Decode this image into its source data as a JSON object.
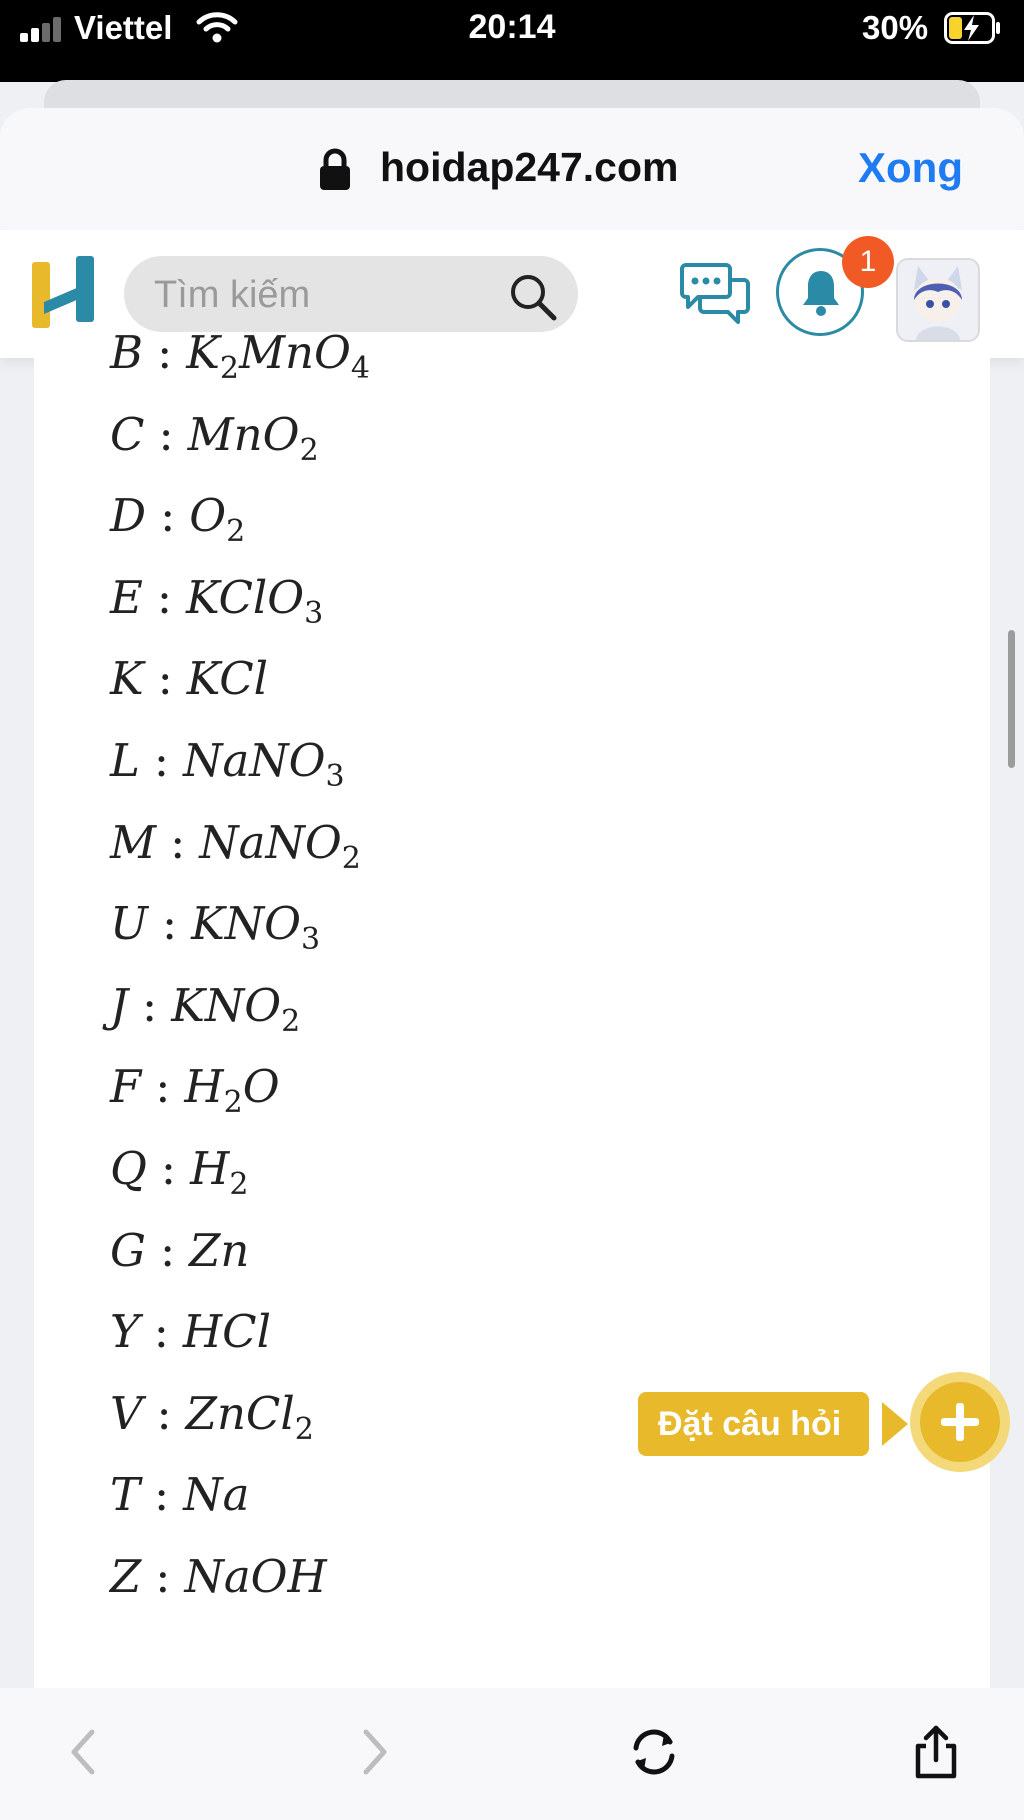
{
  "status_bar": {
    "carrier": "Viettel",
    "time": "20:14",
    "battery_percent": "30%",
    "battery_level": 0.3
  },
  "browser": {
    "url": "hoidap247.com",
    "done_label": "Xong"
  },
  "site": {
    "search_placeholder": "Tìm kiếm",
    "notification_count": "1",
    "ask_label": "Đặt câu hỏi"
  },
  "answers": [
    {
      "letter": "B",
      "formula": [
        [
          "K",
          ""
        ],
        [
          "2",
          "sub"
        ],
        [
          "MnO",
          ""
        ],
        [
          "4",
          "sub"
        ]
      ]
    },
    {
      "letter": "C",
      "formula": [
        [
          "MnO",
          ""
        ],
        [
          "2",
          "sub"
        ]
      ]
    },
    {
      "letter": "D",
      "formula": [
        [
          "O",
          ""
        ],
        [
          "2",
          "sub"
        ]
      ]
    },
    {
      "letter": "E",
      "formula": [
        [
          "KClO",
          ""
        ],
        [
          "3",
          "sub"
        ]
      ]
    },
    {
      "letter": "K",
      "formula": [
        [
          "KCl",
          ""
        ]
      ]
    },
    {
      "letter": "L",
      "formula": [
        [
          "NaNO",
          ""
        ],
        [
          "3",
          "sub"
        ]
      ]
    },
    {
      "letter": "M",
      "formula": [
        [
          "NaNO",
          ""
        ],
        [
          "2",
          "sub"
        ]
      ]
    },
    {
      "letter": "U",
      "formula": [
        [
          "KNO",
          ""
        ],
        [
          "3",
          "sub"
        ]
      ]
    },
    {
      "letter": "J",
      "formula": [
        [
          "KNO",
          ""
        ],
        [
          "2",
          "sub"
        ]
      ]
    },
    {
      "letter": "F",
      "formula": [
        [
          "H",
          ""
        ],
        [
          "2",
          "sub"
        ],
        [
          "O",
          ""
        ]
      ]
    },
    {
      "letter": "Q",
      "formula": [
        [
          "H",
          ""
        ],
        [
          "2",
          "sub"
        ]
      ]
    },
    {
      "letter": "G",
      "formula": [
        [
          "Zn",
          ""
        ]
      ]
    },
    {
      "letter": "Y",
      "formula": [
        [
          "HCl",
          ""
        ]
      ]
    },
    {
      "letter": "V",
      "formula": [
        [
          "ZnCl",
          ""
        ],
        [
          "2",
          "sub"
        ]
      ]
    },
    {
      "letter": "T",
      "formula": [
        [
          "Na",
          ""
        ]
      ]
    },
    {
      "letter": "Z",
      "formula": [
        [
          "NaOH",
          ""
        ]
      ]
    }
  ],
  "icons": {
    "lock": "lock-icon",
    "search": "search-icon",
    "chat": "chat-icon",
    "bell": "bell-icon",
    "plus": "plus-icon",
    "back": "chevron-left-icon",
    "forward": "chevron-right-icon",
    "reload": "reload-icon",
    "share": "share-icon"
  },
  "colors": {
    "accent_blue": "#1e7bf2",
    "brand_yellow": "#e8b92a",
    "brand_teal": "#2b8aa5",
    "badge_orange": "#f15a24"
  }
}
